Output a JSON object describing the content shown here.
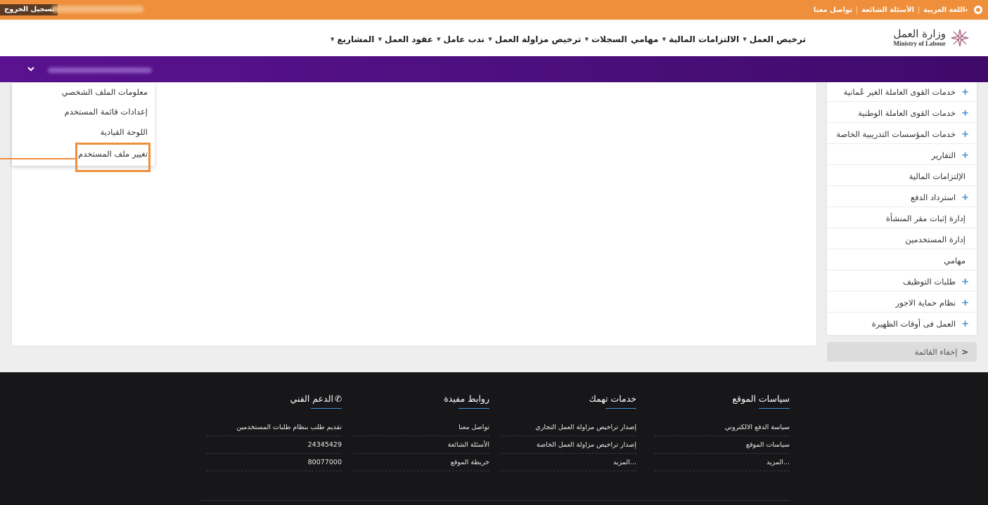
{
  "topbar": {
    "logout_label": "تسجيل الخروج",
    "links": [
      "اللغة العربية",
      "الأسئلة الشائعة",
      "تواصل معنا"
    ],
    "language_caret": "▾"
  },
  "header": {
    "logo_ar": "وزارة العمل",
    "logo_en": "Ministry of Labour",
    "nav": [
      {
        "label": "ترخيص العمل",
        "has_caret": true
      },
      {
        "label": "الالتزامات المالية",
        "has_caret": true
      },
      {
        "label": "مهامي",
        "has_caret": false
      },
      {
        "label": "السجلات",
        "has_caret": true
      },
      {
        "label": "ترخيص مزاولة العمل",
        "has_caret": true
      },
      {
        "label": "ندب عامل",
        "has_caret": true
      },
      {
        "label": "عقود العمل",
        "has_caret": true
      },
      {
        "label": "المشاريع",
        "has_caret": true
      }
    ]
  },
  "profile_dropdown": {
    "items": [
      "معلومات الملف الشخصي",
      "إعدادات قائمة المستخدم",
      "اللوحة القيادية",
      "تغيير ملف المستخدم"
    ],
    "highlighted_index": 3
  },
  "sidebar": {
    "items": [
      {
        "label": "خدمات القوى العاملة الغير عُمانية",
        "plus": true
      },
      {
        "label": "خدمات القوى العاملة الوطنية",
        "plus": true
      },
      {
        "label": "خدمات المؤسسات التدريبية الخاصة",
        "plus": true
      },
      {
        "label": "التقارير",
        "plus": true
      },
      {
        "label": "الإلتزامات المالية",
        "plus": false
      },
      {
        "label": "استرداد الدفع",
        "plus": true
      },
      {
        "label": "إدارة إثبات مقر المنشأة",
        "plus": false
      },
      {
        "label": "إدارة المستخدمين",
        "plus": false
      },
      {
        "label": "مهامي",
        "plus": false
      },
      {
        "label": "طلبات التوظيف",
        "plus": true
      },
      {
        "label": "نظام حماية الاجور",
        "plus": true
      },
      {
        "label": "العمل فى أوقات الظهيرة",
        "plus": true
      }
    ],
    "hide_label": "إخفاء القائمة"
  },
  "footer": {
    "columns": [
      {
        "title": "سياسات الموقع",
        "links": [
          "سياسة الدفع الالكتروني",
          "سياسات الموقع",
          "المزيد..."
        ]
      },
      {
        "title": "خدمات تهمك",
        "links": [
          "إصدار تراخيص مزاولة العمل التجاري",
          "إصدار تراخيص مزاولة العمل الخاصة",
          "المزيد..."
        ]
      },
      {
        "title": "روابط مفيدة",
        "links": [
          "تواصل معنا",
          "الأسئلة الشائعة",
          "خريطة الموقع"
        ]
      },
      {
        "title": "الدعم الفني",
        "links": [
          "تقديم طلب بنظام طلبات المستخدمين",
          "24345429",
          "80077000"
        ]
      }
    ]
  },
  "colors": {
    "topbar": "#ef8f3b",
    "purple": "#4c0f7d",
    "accent_blue": "#3a8fd8",
    "footer": "#171719",
    "highlight": "#ef8f3b"
  }
}
